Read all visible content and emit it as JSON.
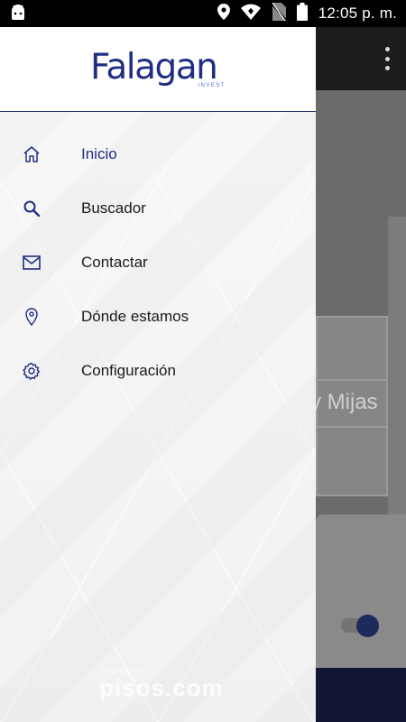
{
  "status_bar": {
    "time": "12:05 p. m.",
    "icons": [
      "android-icon",
      "location-icon",
      "wifi-icon",
      "no-sim-icon",
      "battery-icon"
    ]
  },
  "background_app": {
    "hero_text_fragment": "y Mijas",
    "toolbar_icon": "more-vert-icon"
  },
  "drawer": {
    "logo": {
      "wordmark": "Falagan",
      "subtitle": "INVEST"
    },
    "items": [
      {
        "label": "Inicio",
        "icon": "home-icon",
        "active": true
      },
      {
        "label": "Buscador",
        "icon": "search-icon",
        "active": false
      },
      {
        "label": "Contactar",
        "icon": "mail-icon",
        "active": false
      },
      {
        "label": "Dónde estamos",
        "icon": "location-pin-icon",
        "active": false
      },
      {
        "label": "Configuración",
        "icon": "settings-gear-icon",
        "active": false
      }
    ],
    "footer": {
      "powered_by": "Powered by",
      "brand": "pisos.com"
    }
  },
  "colors": {
    "brand_navy": "#1f2e84",
    "status_bar": "#000000",
    "drawer_background": "#f6f6f6",
    "text_primary": "#1a1a1a"
  }
}
